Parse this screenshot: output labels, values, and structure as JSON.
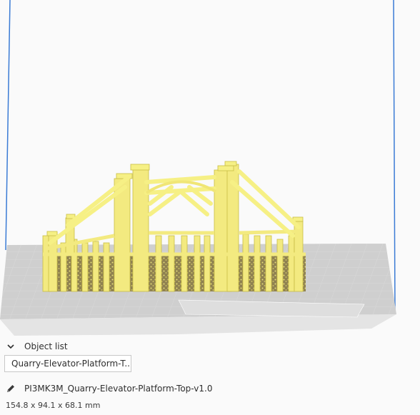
{
  "object_list": {
    "header_label": "Object list",
    "collapse_icon": "chevron-down-icon",
    "items": [
      "Quarry-Elevator-Platform-T..."
    ]
  },
  "file": {
    "edit_icon": "pencil-icon",
    "name": "PI3MK3M_Quarry-Elevator-Platform-Top-v1.0",
    "dimensions": "154.8 x 94.1 x 68.1 mm"
  },
  "colors": {
    "model": "#f6f085",
    "model_shadow": "#8a7a45",
    "build_volume": "#3a7bd5",
    "bed": "#c8c8c8"
  }
}
